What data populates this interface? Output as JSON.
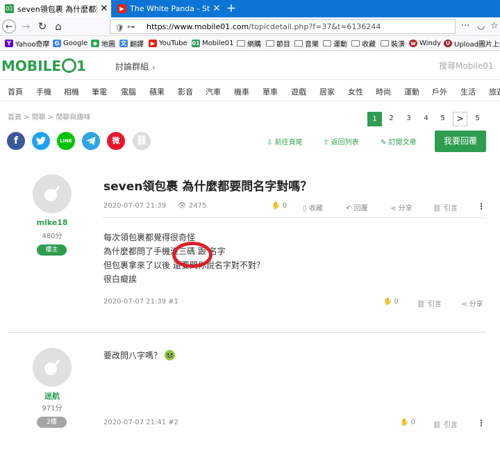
{
  "browser": {
    "tabs": [
      {
        "title": "seven領包裹 為什麼都要問名",
        "active": true
      },
      {
        "title": "The White Panda - Stereo",
        "active": false
      }
    ],
    "new_tab": "+",
    "url_host": "https://www.mobile01.com",
    "url_path": "/topicdetail.php?f=37&t=6136244",
    "more": "···",
    "bookmarks": [
      "Yahoo奇摩",
      "Google",
      "地圖",
      "翻譯",
      "YouTube",
      "Mobile01",
      "網購",
      "節目",
      "音樂",
      "運動",
      "收藏",
      "裝潢",
      "Windy",
      "Upload圖片上傳"
    ]
  },
  "site": {
    "logo_text": "MOBILE",
    "logo_one": "1",
    "forum_menu": "討論群組",
    "search_placeholder": "搜尋Mobile01",
    "categories": [
      "首頁",
      "手機",
      "相機",
      "筆電",
      "電腦",
      "蘋果",
      "影音",
      "汽車",
      "機車",
      "單車",
      "遊戲",
      "居家",
      "女性",
      "時尚",
      "運動",
      "戶外",
      "生活",
      "旅遊"
    ]
  },
  "breadcrumb": {
    "home": "首頁",
    "sep": ">",
    "forum": "閒聊",
    "sub": "閒聊與趣味"
  },
  "pagination": {
    "pages": [
      "1",
      "2",
      "3",
      "4",
      "5"
    ],
    "next": ">",
    "last": "5",
    "current": "1"
  },
  "share_icons": [
    "facebook-icon",
    "twitter-icon",
    "line-icon",
    "telegram-icon",
    "weibo-icon",
    "link-icon"
  ],
  "share_labels": {
    "line": "LINE",
    "facebook": "f",
    "weibo": "微"
  },
  "actions": {
    "goto_end": "前往頁尾",
    "back_list": "返回列表",
    "subscribe": "訂閱文章",
    "reply": "我要回覆"
  },
  "topic": {
    "title": "seven領包裹 為什麼都要問名字對嗎？"
  },
  "posts": [
    {
      "user": "mike18",
      "points": "480分",
      "floor": "樓主",
      "date": "2020-07-07 21:39",
      "views": "2475",
      "like_count": "0",
      "save": "收藏",
      "quote": "回覆",
      "share": "分享",
      "cite": "引言",
      "lines": [
        "每次領包裹都覺得很奇怪",
        "為什麼都問了手機沒三碼 跟 名字",
        "但包裹拿來了以後 還要問你說名字對不對？",
        "很白癡誒"
      ],
      "footer_date": "2020-07-07 21:39 #1",
      "footer_like": "0",
      "footer_cite": "引言",
      "footer_share": "分享"
    },
    {
      "user": "迷航",
      "points": "971分",
      "floor": "2樓",
      "text": "要改問八字嗎？",
      "footer_date": "2020-07-07 21:41 #2",
      "footer_like": "0",
      "footer_cite": "引言"
    }
  ],
  "colors": {
    "brand_green": "#2f9d4f",
    "tab_blue": "#0c74d4",
    "annotation_red": "#d8202b"
  }
}
